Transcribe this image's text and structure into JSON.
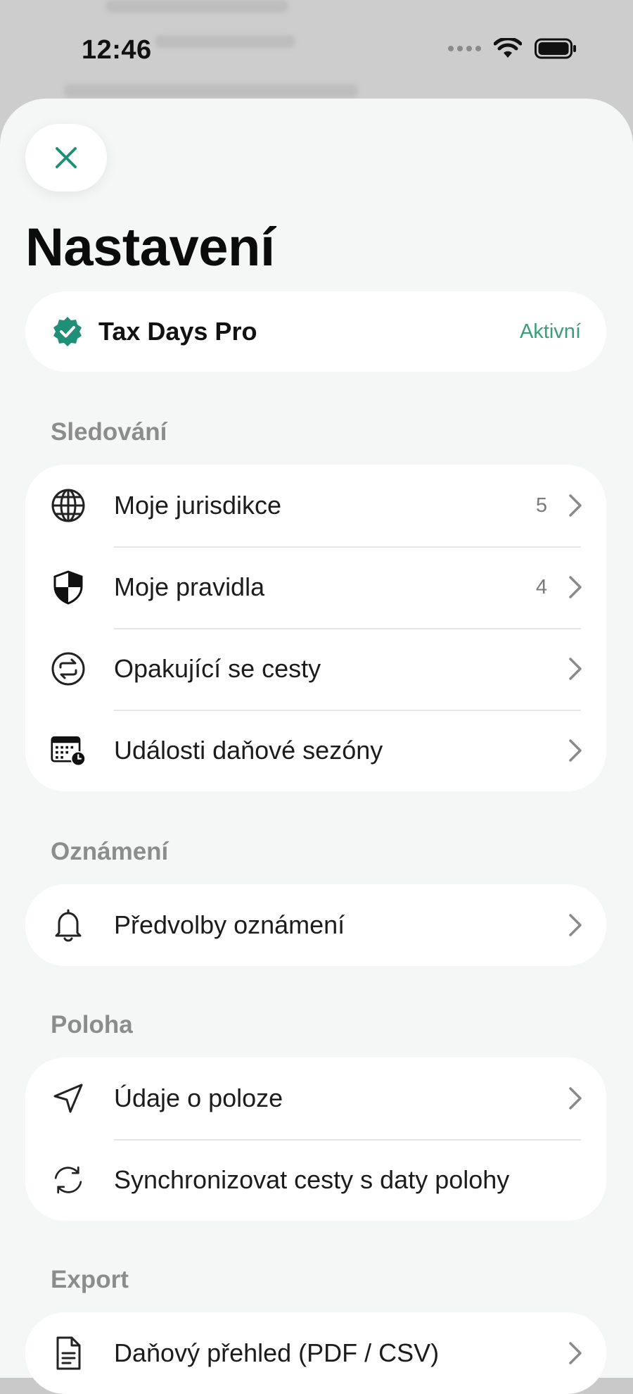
{
  "status_bar": {
    "time": "12:46"
  },
  "header": {
    "close_icon": "close-icon",
    "title": "Nastavení"
  },
  "pro": {
    "name": "Tax Days Pro",
    "status": "Aktivní",
    "icon": "verified-badge-icon"
  },
  "sections": [
    {
      "title": "Sledování",
      "items": [
        {
          "label": "Moje jurisdikce",
          "count": "5",
          "icon": "globe-icon"
        },
        {
          "label": "Moje pravidla",
          "count": "4",
          "icon": "shield-icon"
        },
        {
          "label": "Opakující se cesty",
          "count": "",
          "icon": "repeat-icon"
        },
        {
          "label": "Události daňové sezóny",
          "count": "",
          "icon": "calendar-clock-icon"
        }
      ]
    },
    {
      "title": "Oznámení",
      "items": [
        {
          "label": "Předvolby oznámení",
          "count": "",
          "icon": "bell-icon"
        }
      ]
    },
    {
      "title": "Poloha",
      "items": [
        {
          "label": "Údaje o poloze",
          "count": "",
          "icon": "location-arrow-icon"
        },
        {
          "label": "Synchronizovat cesty s daty polohy",
          "count": "",
          "icon": "sync-icon"
        }
      ]
    },
    {
      "title": "Export",
      "items": [
        {
          "label": "Daňový přehled (PDF / CSV)",
          "count": "",
          "icon": "document-icon"
        }
      ]
    }
  ],
  "colors": {
    "accent": "#1f8f78",
    "active_text": "#3a9e7a",
    "sheet_bg": "#f5f6f6"
  }
}
